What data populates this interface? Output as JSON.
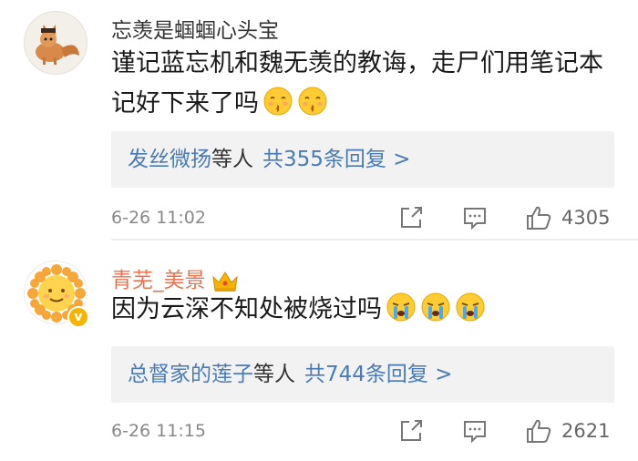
{
  "comments": [
    {
      "username": "忘羡是蝈蝈心头宝",
      "text": "谨记蓝忘机和魏无羡的教诲，走尸们用笔记本记好下来了吗",
      "emoji": [
        "kiss-emoji",
        "kiss-emoji"
      ],
      "replies": {
        "names": "发丝微扬",
        "others": "等人",
        "count": "共355条回复 >"
      },
      "time": "6-26 11:02",
      "likes": "4305"
    },
    {
      "username": "青芜_美景",
      "badge": "crown-icon",
      "verified": "v",
      "text": "因为云深不知处被烧过吗",
      "emoji": [
        "crying-emoji",
        "crying-emoji",
        "crying-emoji"
      ],
      "replies": {
        "names": "总督家的莲子",
        "others": "等人",
        "count": "共744条回复 >"
      },
      "time": "6-26 11:15",
      "likes": "2621"
    }
  ]
}
